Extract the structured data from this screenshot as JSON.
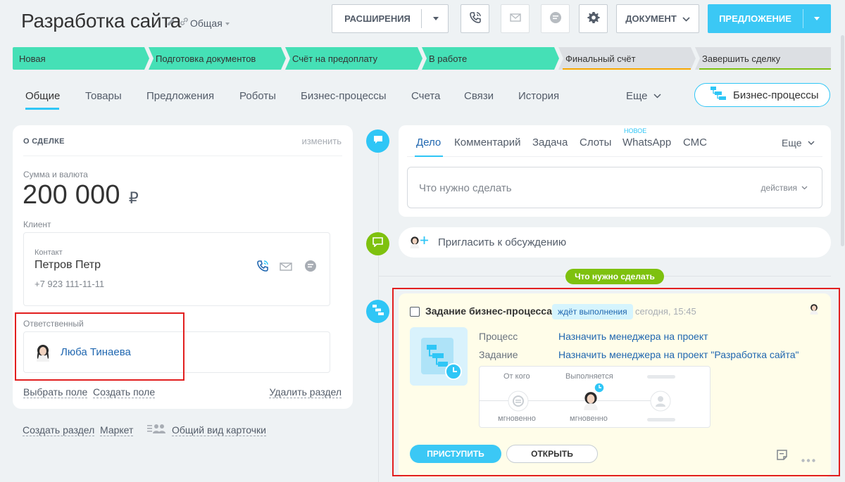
{
  "header": {
    "title": "Разработка сайта",
    "category": "Общая",
    "buttons": {
      "extensions": "РАСШИРЕНИЯ",
      "document": "ДОКУМЕНТ",
      "offer": "ПРЕДЛОЖЕНИЕ"
    },
    "icons": [
      "phone-icon",
      "mail-icon",
      "chat-icon",
      "gear-icon"
    ]
  },
  "stages": [
    {
      "label": "Новая",
      "status": "done"
    },
    {
      "label": "Подготовка документов",
      "status": "done"
    },
    {
      "label": "Счёт на предоплату",
      "status": "done"
    },
    {
      "label": "В работе",
      "status": "done"
    },
    {
      "label": "Финальный счёт",
      "status": "todo"
    },
    {
      "label": "Завершить сделку",
      "status": "todo"
    }
  ],
  "tabs": [
    "Общие",
    "Товары",
    "Предложения",
    "Роботы",
    "Бизнес-процессы",
    "Счета",
    "Связи",
    "История"
  ],
  "tabs_more": "Еще",
  "bp_button": "Бизнес-процессы",
  "deal": {
    "section_title": "О СДЕЛКЕ",
    "edit": "изменить",
    "amount_label": "Сумма и валюта",
    "amount": "200 000",
    "currency": "₽",
    "client_label": "Клиент",
    "contact_type": "Контакт",
    "contact_name": "Петров Петр",
    "contact_phone": "+7 923 111-11-11",
    "responsible_label": "Ответственный",
    "responsible_name": "Люба Тинаева",
    "select_field": "Выбрать поле",
    "create_field": "Создать поле",
    "delete_section": "Удалить раздел"
  },
  "bottom_links": {
    "create_section": "Создать раздел",
    "market": "Маркет",
    "common_view": "Общий вид карточки"
  },
  "activity": {
    "tabs": [
      "Дело",
      "Комментарий",
      "Задача",
      "Слоты",
      "WhatsApp",
      "СМС"
    ],
    "new_badge": "НОВОЕ",
    "more": "Еще",
    "todo_placeholder": "Что нужно сделать",
    "actions": "действия",
    "invite": "Пригласить к обсуждению",
    "section_label": "Что нужно сделать"
  },
  "task": {
    "title": "Задание бизнес-процесса",
    "status": "ждёт выполнения",
    "time": "сегодня, 15:45",
    "process_label": "Процесс",
    "process_value": "Назначить менеджера на проект",
    "task_label": "Задание",
    "task_value": "Назначить менеджера на проект \"Разработка сайта\"",
    "from_label": "От кого",
    "executing_label": "Выполняется",
    "instant_1": "мгновенно",
    "instant_2": "мгновенно",
    "start_button": "ПРИСТУПИТЬ",
    "open_button": "ОТКРЫТЬ"
  },
  "colors": {
    "accent": "#2fc6f6",
    "stage_done": "#45e0b6",
    "stage_todo": "#dcdfe3",
    "link": "#2067b0",
    "highlight": "#e21f1f",
    "task_bg": "#fffde9",
    "timeline_green": "#7ec10e"
  }
}
